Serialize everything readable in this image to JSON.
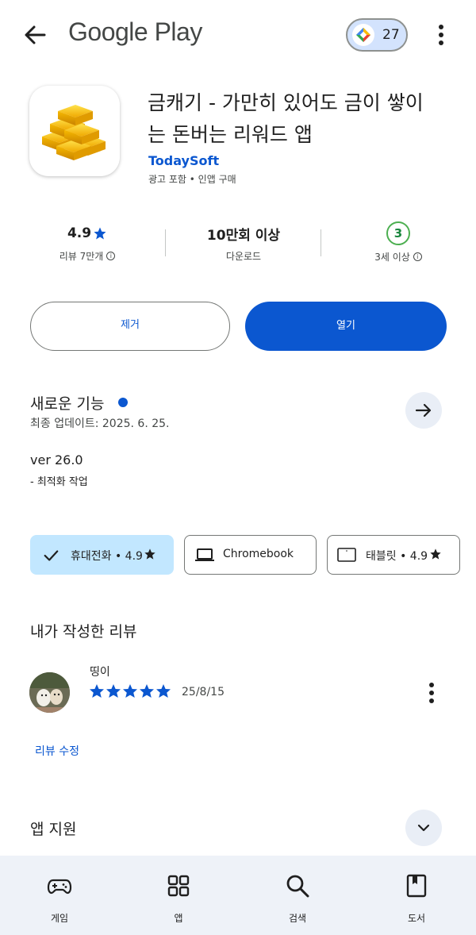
{
  "header": {
    "store_title": "Google Play",
    "points_count": "27",
    "back_icon": "arrow-back-icon",
    "menu_icon": "more-vert-icon"
  },
  "app": {
    "name": "금캐기 - 가만히 있어도 금이 쌓이는 돈버는 리워드 앱",
    "developer": "TodaySoft",
    "meta": "광고 포함 • 인앱 구매",
    "icon": "gold-bars-icon"
  },
  "stats": {
    "rating": "4.9",
    "rating_label": "리뷰 7만개",
    "downloads": "10만회 이상",
    "downloads_label": "다운로드",
    "age_rating": "3",
    "age_label": "3세 이상"
  },
  "actions": {
    "uninstall_label": "제거",
    "open_label": "열기"
  },
  "whats_new": {
    "title": "새로운 기능",
    "updated": "최종 업데이트: 2025. 6. 25.",
    "version": "ver 26.0",
    "notes": "- 최적화 작업"
  },
  "devices": [
    {
      "label": "휴대전화 • 4.9",
      "selected": true,
      "icon": "check-icon"
    },
    {
      "label": "Chromebook",
      "selected": false,
      "icon": "laptop-icon"
    },
    {
      "label": "태블릿 • 4.9",
      "selected": false,
      "icon": "tablet-icon"
    }
  ],
  "my_review": {
    "title": "내가 작성한 리뷰",
    "reviewer": "띵이",
    "stars": 5,
    "date": "25/8/15",
    "edit_label": "리뷰 수정"
  },
  "app_support": {
    "title": "앱 지원"
  },
  "bottom_nav": [
    {
      "label": "게임",
      "icon": "gamepad-icon"
    },
    {
      "label": "앱",
      "icon": "apps-grid-icon"
    },
    {
      "label": "검색",
      "icon": "search-icon"
    },
    {
      "label": "도서",
      "icon": "book-icon"
    }
  ],
  "colors": {
    "accent": "#0b57d0",
    "chip_selected": "#c2e7ff",
    "nav_bg": "#eef2f8",
    "age_badge": "#4caf50"
  }
}
